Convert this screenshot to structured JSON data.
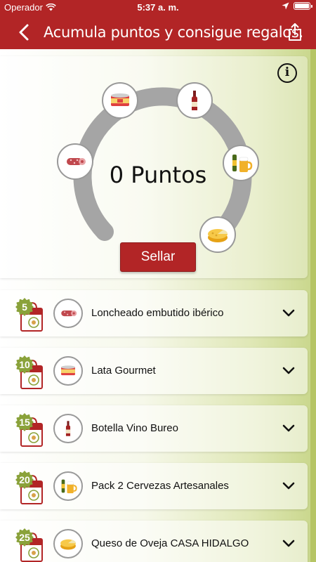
{
  "status_bar": {
    "carrier": "Operador",
    "time": "5:37 a. m.",
    "icons": [
      "wifi-icon",
      "location-arrow-icon",
      "battery-icon"
    ]
  },
  "nav": {
    "back_icon": "chevron-left-icon",
    "title": "Acumula puntos y consigue regalos.",
    "share_icon": "share-icon"
  },
  "points": {
    "label": "0 Puntos",
    "info_label": "i",
    "seal_button": "Sellar",
    "progress": 0,
    "reward_icons": [
      "sausage-icon",
      "gourmet-can-icon",
      "wine-bottle-icon",
      "beer-icon",
      "cheese-icon"
    ]
  },
  "rewards": [
    {
      "points": "5",
      "name": "Loncheado embutido ibérico",
      "icon": "sausage-icon"
    },
    {
      "points": "10",
      "name": "Lata Gourmet",
      "icon": "gourmet-can-icon"
    },
    {
      "points": "15",
      "name": "Botella Vino Bureo",
      "icon": "wine-bottle-icon"
    },
    {
      "points": "20",
      "name": "Pack 2 Cervezas Artesanales",
      "icon": "beer-icon"
    },
    {
      "points": "25",
      "name": "Queso de Oveja CASA HIDALGO",
      "icon": "cheese-icon"
    }
  ],
  "colors": {
    "brand_red": "#b22526",
    "accent_green": "#b6c565",
    "arc_gray": "#a5a5a5"
  }
}
